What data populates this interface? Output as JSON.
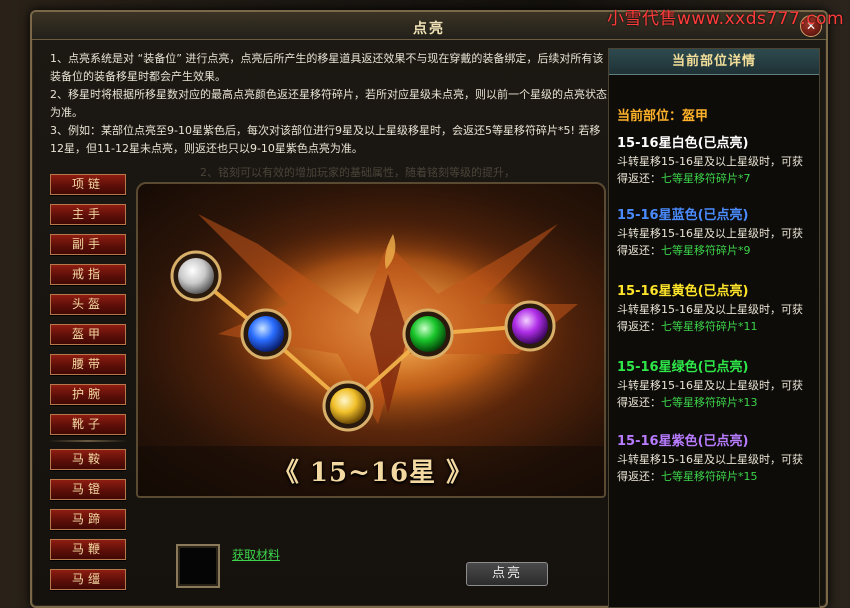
{
  "watermark": "小雪代售www.xxds777.com",
  "window": {
    "title": "点亮",
    "close_label": "✕"
  },
  "description": [
    "1、点亮系统是对 “装备位” 进行点亮，点亮后所产生的移星道具返还效果不与现在穿戴的装备绑定，后续对所有该装备位的装备移星时都会产生效果。",
    "2、移星时将根据所移星数对应的最高点亮颜色返还星移符碎片，若所对应星级未点亮，则以前一个星级的点亮状态为准。",
    "3、例如：某部位点亮至9-10星紫色后，每次对该部位进行9星及以上星级移星时，会返还5等星移符碎片*5! 若移12星，但11-12星未点亮，则返还也只以9-10星紫色点亮为准。"
  ],
  "background_hint": "2、铭刻可以有效的增加玩家的基础属性，随着铭刻等级的提升，",
  "equipment_slots": [
    "项链",
    "主手",
    "副手",
    "戒指",
    "头盔",
    "盔甲",
    "腰带",
    "护腕",
    "靴子",
    "马鞍",
    "马镫",
    "马蹄",
    "马鞭",
    "马缰"
  ],
  "scene": {
    "tier_label": "15~16星",
    "left_arrow": "《",
    "right_arrow": "》",
    "orbs": [
      "white",
      "blue",
      "yellow",
      "green",
      "purple"
    ]
  },
  "bottom": {
    "material_link": "获取材料",
    "ignite_button": "点亮"
  },
  "details": {
    "header": "当前部位详情",
    "current_part_label": "当前部位：",
    "current_part": "盔甲",
    "tiers": [
      {
        "title": "15-16星白色(已点亮)",
        "color": "#ffffff",
        "line1": "斗转星移15-16星及以上星级时，可获",
        "line2_prefix": "得返还：",
        "reward": "七等星移符碎片*7"
      },
      {
        "title": "15-16星蓝色(已点亮)",
        "color": "#4a8cff",
        "line1": "斗转星移15-16星及以上星级时，可获",
        "line2_prefix": "得返还：",
        "reward": "七等星移符碎片*9"
      },
      {
        "title": "15-16星黄色(已点亮)",
        "color": "#ffe52a",
        "line1": "斗转星移15-16星及以上星级时，可获",
        "line2_prefix": "得返还：",
        "reward": "七等星移符碎片*11"
      },
      {
        "title": "15-16星绿色(已点亮)",
        "color": "#2ee84a",
        "line1": "斗转星移15-16星及以上星级时，可获",
        "line2_prefix": "得返还：",
        "reward": "七等星移符碎片*13"
      },
      {
        "title": "15-16星紫色(已点亮)",
        "color": "#b77cff",
        "line1": "斗转星移15-16星及以上星级时，可获",
        "line2_prefix": "得返还：",
        "reward": "七等星移符碎片*15"
      }
    ]
  }
}
